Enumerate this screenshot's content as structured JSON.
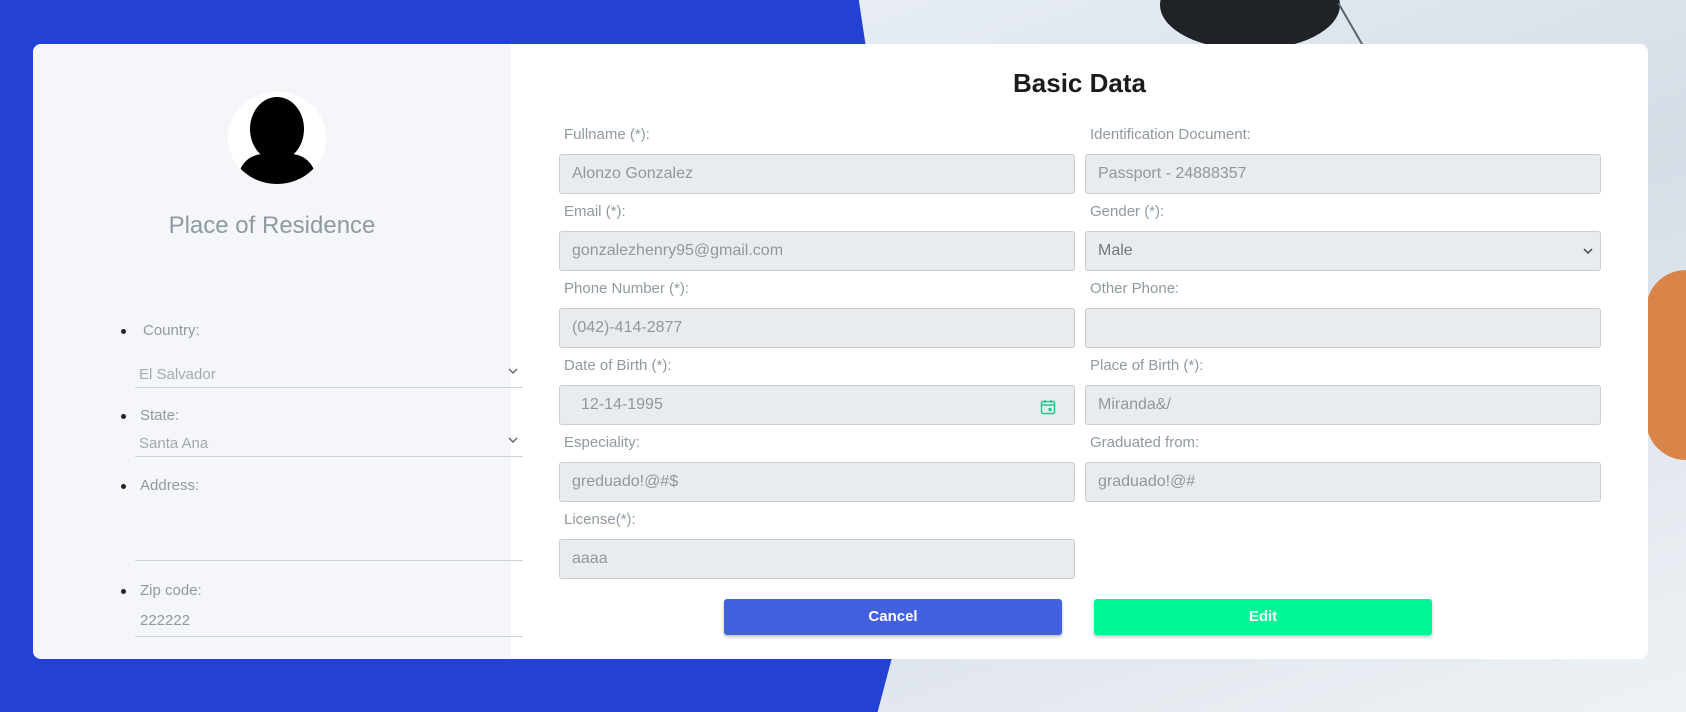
{
  "colors": {
    "page_bg": "#2341d2",
    "accent_cancel": "#4361df",
    "accent_edit": "#00f595",
    "calendar_icon": "#20c787"
  },
  "sidebar": {
    "title": "Place of Residence",
    "avatar_icon": "user-silhouette-icon",
    "country": {
      "label": "Country:",
      "value": "El Salvador"
    },
    "state": {
      "label": "State:",
      "value": "Santa Ana"
    },
    "address": {
      "label": "Address:",
      "value": ""
    },
    "zip": {
      "label": "Zip code:",
      "value": "222222"
    }
  },
  "form": {
    "title": "Basic Data",
    "fullname": {
      "label": "Fullname (*):",
      "value": "Alonzo Gonzalez"
    },
    "id_doc": {
      "label": "Identification Document:",
      "value": "Passport - 24888357"
    },
    "email": {
      "label": "Email (*):",
      "value": "gonzalezhenry95@gmail.com"
    },
    "gender": {
      "label": "Gender (*):",
      "value": "Male"
    },
    "phone": {
      "label": "Phone Number (*):",
      "value": "(042)-414-2877"
    },
    "other_phone": {
      "label": "Other Phone:",
      "value": ""
    },
    "dob": {
      "label": "Date of Birth (*):",
      "value": "12-14-1995"
    },
    "pob": {
      "label": "Place of Birth (*):",
      "value": "Miranda&/"
    },
    "especiality": {
      "label": "Especiality:",
      "value": "greduado!@#$"
    },
    "graduated": {
      "label": "Graduated from:",
      "value": "graduado!@#"
    },
    "license": {
      "label": "License(*):",
      "value": "aaaa"
    }
  },
  "buttons": {
    "cancel": "Cancel",
    "edit": "Edit"
  }
}
